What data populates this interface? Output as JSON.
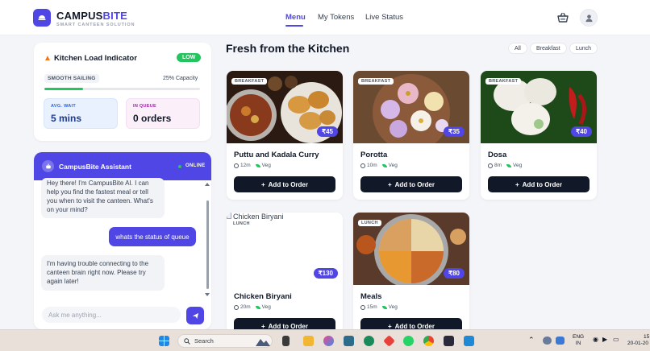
{
  "header": {
    "brand_main": "CAMPUS",
    "brand_accent": "BITE",
    "tagline": "SMART CANTEEN SOLUTION",
    "nav": [
      "Menu",
      "My Tokens",
      "Live Status"
    ],
    "accent_color": "#4f46e5"
  },
  "load": {
    "title": "Kitchen Load Indicator",
    "status_badge": "LOW",
    "status_text": "SMOOTH SAILING",
    "capacity_text": "25% Capacity",
    "capacity_value": 0.25,
    "avg_wait_label": "AVG. WAIT",
    "avg_wait_value": "5 mins",
    "queue_label": "IN QUEUE",
    "queue_value": "0 orders"
  },
  "chat": {
    "title": "CampusBite Assistant",
    "status": "ONLINE",
    "messages": [
      {
        "from": "bot",
        "text": "Hey there! I'm CampusBite AI. I can help you find the fastest meal or tell you when to visit the canteen. What's on your mind?"
      },
      {
        "from": "user",
        "text": "whats the status of queue"
      },
      {
        "from": "bot",
        "text": "I'm having trouble connecting to the canteen brain right now. Please try again later!"
      }
    ],
    "input_placeholder": "Ask me anything..."
  },
  "main": {
    "title": "Fresh from the Kitchen",
    "filters": [
      "All",
      "Breakfast",
      "Lunch"
    ],
    "order_label": "Add to Order",
    "items": [
      {
        "name": "Puttu and Kadala Curry",
        "category": "BREAKFAST",
        "price": "₹45",
        "time": "12m",
        "diet": "Veg"
      },
      {
        "name": "Porotta",
        "category": "BREAKFAST",
        "price": "₹35",
        "time": "10m",
        "diet": "Veg"
      },
      {
        "name": "Dosa",
        "category": "BREAKFAST",
        "price": "₹40",
        "time": "8m",
        "diet": "Veg"
      },
      {
        "name": "Chicken Biryani",
        "category": "LUNCH",
        "price": "₹130",
        "time": "20m",
        "diet": "Veg",
        "image_alt": "Chicken Biryani"
      },
      {
        "name": "Meals",
        "category": "LUNCH",
        "price": "₹80",
        "time": "15m",
        "diet": "Veg"
      }
    ]
  },
  "taskbar": {
    "search_label": "Search",
    "lang_top": "ENG",
    "lang_bottom": "IN",
    "time": "15",
    "date": "20-01-20"
  }
}
